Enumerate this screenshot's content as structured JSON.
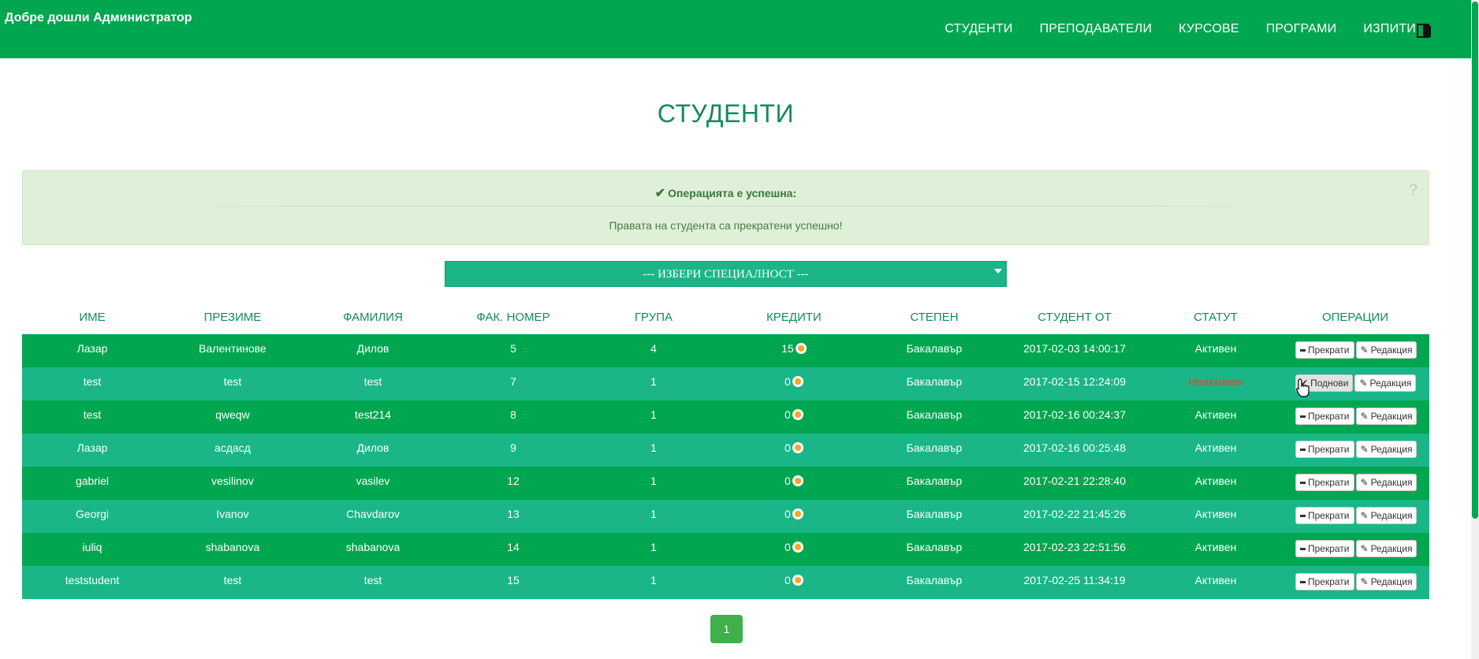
{
  "header": {
    "welcome": "Добре дошли Администратор",
    "nav": [
      "СТУДЕНТИ",
      "ПРЕПОДАВАТЕЛИ",
      "КУРСОВЕ",
      "ПРОГРАМИ",
      "ИЗПИТИ"
    ],
    "logout_icon": "logout-door-icon"
  },
  "page": {
    "title": "СТУДЕНТИ"
  },
  "alert": {
    "heading": "Операцията е успешна:",
    "message": "Правата на студента са прекратени успешно!",
    "help": "?"
  },
  "filter": {
    "selected": "--- ИЗБЕРИ СПЕЦИАЛНОСТ ---"
  },
  "table": {
    "headers": [
      "ИМЕ",
      "ПРЕЗИМЕ",
      "ФАМИЛИЯ",
      "ФАК. НОМЕР",
      "ГРУПА",
      "КРЕДИТИ",
      "СТЕПЕН",
      "СТУДЕНТ ОТ",
      "СТАТУТ",
      "ОПЕРАЦИИ"
    ],
    "rows": [
      {
        "first": "Лазар",
        "middle": "Валентинове",
        "last": "Дилов",
        "fac": "5",
        "group": "4",
        "credits": "15",
        "degree": "Бакалавър",
        "since": "2017-02-03 14:00:17",
        "status": "Активен",
        "active": true,
        "action": "Прекрати",
        "edit": "Редакция"
      },
      {
        "first": "test",
        "middle": "test",
        "last": "test",
        "fac": "7",
        "group": "1",
        "credits": "0",
        "degree": "Бакалавър",
        "since": "2017-02-15 12:24:09",
        "status": "Неактивен",
        "active": false,
        "action": "Поднови",
        "edit": "Редакция"
      },
      {
        "first": "test",
        "middle": "qweqw",
        "last": "test214",
        "fac": "8",
        "group": "1",
        "credits": "0",
        "degree": "Бакалавър",
        "since": "2017-02-16 00:24:37",
        "status": "Активен",
        "active": true,
        "action": "Прекрати",
        "edit": "Редакция"
      },
      {
        "first": "Лазар",
        "middle": "асдасд",
        "last": "Дилов",
        "fac": "9",
        "group": "1",
        "credits": "0",
        "degree": "Бакалавър",
        "since": "2017-02-16 00:25:48",
        "status": "Активен",
        "active": true,
        "action": "Прекрати",
        "edit": "Редакция"
      },
      {
        "first": "gabriel",
        "middle": "vesilinov",
        "last": "vasilev",
        "fac": "12",
        "group": "1",
        "credits": "0",
        "degree": "Бакалавър",
        "since": "2017-02-21 22:28:40",
        "status": "Активен",
        "active": true,
        "action": "Прекрати",
        "edit": "Редакция"
      },
      {
        "first": "Georgi",
        "middle": "Ivanov",
        "last": "Chavdarov",
        "fac": "13",
        "group": "1",
        "credits": "0",
        "degree": "Бакалавър",
        "since": "2017-02-22 21:45:26",
        "status": "Активен",
        "active": true,
        "action": "Прекрати",
        "edit": "Редакция"
      },
      {
        "first": "iuliq",
        "middle": "shabanova",
        "last": "shabanova",
        "fac": "14",
        "group": "1",
        "credits": "0",
        "degree": "Бакалавър",
        "since": "2017-02-23 22:51:56",
        "status": "Активен",
        "active": true,
        "action": "Прекрати",
        "edit": "Редакция"
      },
      {
        "first": "teststudent",
        "middle": "test",
        "last": "test",
        "fac": "15",
        "group": "1",
        "credits": "0",
        "degree": "Бакалавър",
        "since": "2017-02-25 11:34:19",
        "status": "Активен",
        "active": true,
        "action": "Прекрати",
        "edit": "Редакция"
      }
    ]
  },
  "pagination": {
    "current": "1"
  },
  "colors": {
    "primary": "#00a650",
    "row_alt": "#1ab688",
    "title": "#138a5a",
    "inactive": "#e8412b",
    "alert_bg": "#dff0d8"
  }
}
